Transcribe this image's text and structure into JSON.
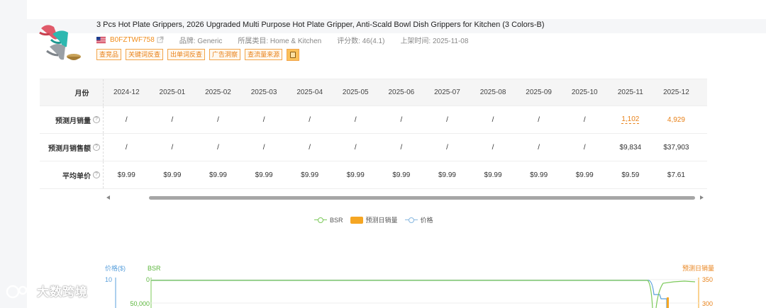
{
  "product": {
    "title": "3 Pcs Hot Plate Grippers, 2026 Upgraded Multi Purpose Hot Plate Gripper, Anti-Scald Bowl Dish Grippers for Kitchen (3 Colors-B)",
    "asin": "B0FZTWF758",
    "brand": "品牌: Generic",
    "category": "所属类目: Home & Kitchen",
    "rating": "评分数: 46(4.1)",
    "listed": "上架时间: 2025-11-08",
    "icons": {
      "flag": "us-flag-icon",
      "external": "external-link-icon"
    }
  },
  "tags": [
    "查竞品",
    "关键词反查",
    "出单词反查",
    "广告洞察",
    "查流量来源"
  ],
  "table": {
    "header_label": "月份",
    "months": [
      "2024-12",
      "2025-01",
      "2025-02",
      "2025-03",
      "2025-04",
      "2025-05",
      "2025-06",
      "2025-07",
      "2025-08",
      "2025-09",
      "2025-10",
      "2025-11",
      "2025-12"
    ],
    "rows": [
      {
        "label": "预测月销量",
        "values": [
          "/",
          "/",
          "/",
          "/",
          "/",
          "/",
          "/",
          "/",
          "/",
          "/",
          "/",
          "1,102",
          "4,929"
        ]
      },
      {
        "label": "预测月销售额",
        "values": [
          "/",
          "/",
          "/",
          "/",
          "/",
          "/",
          "/",
          "/",
          "/",
          "/",
          "/",
          "$9,834",
          "$37,903"
        ]
      },
      {
        "label": "平均单价",
        "values": [
          "$9.99",
          "$9.99",
          "$9.99",
          "$9.99",
          "$9.99",
          "$9.99",
          "$9.99",
          "$9.99",
          "$9.99",
          "$9.99",
          "$9.99",
          "$9.59",
          "$7.61"
        ]
      }
    ]
  },
  "legend": {
    "bsr": "BSR",
    "sales": "预测日销量",
    "price": "价格"
  },
  "chart_data": {
    "type": "line",
    "axes": {
      "price_title": "价格($)",
      "bsr_title": "BSR",
      "sales_title": "预测日销量",
      "price_ticks": [
        "10"
      ],
      "bsr_ticks": [
        "0",
        "50,000"
      ],
      "sales_ticks": [
        "350",
        "300"
      ]
    },
    "colors": {
      "bsr": "#7cc95a",
      "price": "#5aa0dc",
      "sales": "#f5a623"
    }
  },
  "watermark": "大数跨境"
}
